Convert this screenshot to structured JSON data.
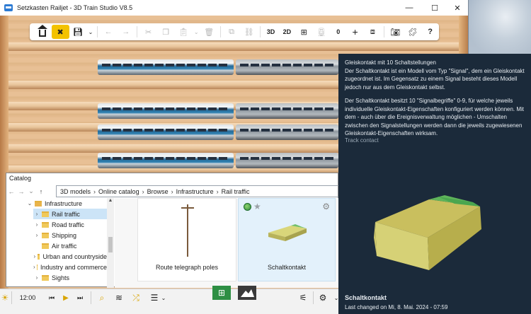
{
  "window": {
    "title": "Setzkasten Railjet - 3D Train Studio V8.5",
    "controls": {
      "minimize": "—",
      "maximize": "☐",
      "close": "✕"
    }
  },
  "toolbar": {
    "view_3d": "3D",
    "view_2d": "2D",
    "counter": "0",
    "icons": [
      "home-icon",
      "tools-icon",
      "save-icon",
      "chevron-down-icon",
      "undo-icon",
      "redo-icon",
      "cut-icon",
      "copy-icon",
      "paste-icon",
      "chevron-down-icon",
      "delete-icon",
      "group-icon",
      "link-icon",
      "grid-icon",
      "train-icon",
      "plus-icon",
      "window-icon",
      "camera-icon",
      "puzzle-icon",
      "help-icon"
    ]
  },
  "catalog": {
    "title": "Catalog",
    "breadcrumb": [
      "3D models",
      "Online catalog",
      "Browse",
      "Infrastructure",
      "Rail traffic"
    ],
    "tree": [
      {
        "label": "Infrastructure",
        "expander": "⌄",
        "indent": 0
      },
      {
        "label": "Rail traffic",
        "expander": "›",
        "indent": 1,
        "selected": true
      },
      {
        "label": "Road traffic",
        "expander": "›",
        "indent": 1
      },
      {
        "label": "Shipping",
        "expander": "›",
        "indent": 1
      },
      {
        "label": "Air traffic",
        "expander": "",
        "indent": 1
      },
      {
        "label": "Urban and countryside",
        "expander": "›",
        "indent": 1
      },
      {
        "label": "Industry and commerce",
        "expander": "›",
        "indent": 1
      },
      {
        "label": "Sights",
        "expander": "›",
        "indent": 1
      }
    ],
    "items": [
      {
        "label": "Route telegraph poles"
      },
      {
        "label": "Schaltkontakt"
      }
    ]
  },
  "bottombar": {
    "time": "12:00"
  },
  "info_panel": {
    "title_line": "Gleiskontakt mit 10 Schaltstellungen",
    "paragraph1": "Der Schaltkontakt ist ein Modell vom Typ \"Signal\", dem ein Gleiskontakt zugeordnet ist. Im Gegensatz zu einem Signal besteht dieses Modell jedoch nur aus dem Gleiskontakt selbst.",
    "paragraph2": "Der Schaltkontakt besitzt 10 \"Signalbegriffe\" 0-9, für welche jeweils individuelle Gleiskontakt-Eigenschaften konfiguriert werden können. Mit dem - auch über die Ereignisverwaltung möglichen - Umschalten zwischen den Signalstellungen werden dann die jeweils zugewiesenen Gleiskontakt-Eigenschaften wirksam.",
    "category": "Track contact",
    "name": "Schaltkontakt",
    "changed": "Last changed on Mi, 8. Mai. 2024 - 07:59"
  },
  "colors": {
    "accent": "#f3c200",
    "panel_bg": "#1b2a3a",
    "selection": "#cce4f7",
    "green_button": "#2e8f44"
  }
}
